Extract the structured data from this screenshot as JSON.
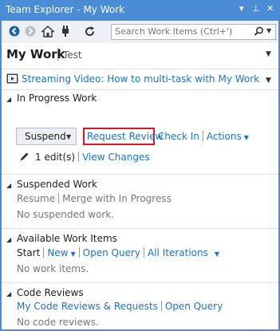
{
  "window": {
    "title": "Team Explorer - My Work",
    "controls": {
      "dropdown": "▾",
      "pin": "⊥",
      "close": "✕"
    }
  },
  "toolbar": {
    "icons": [
      "back-icon",
      "forward-icon",
      "home-icon",
      "connect-icon",
      "refresh-icon"
    ],
    "search_placeholder": "Search Work Items (Ctrl+')"
  },
  "header": {
    "title": "My Work",
    "subtitle": "Test"
  },
  "video": {
    "link_text": "Streaming Video: How to multi-task with My Work"
  },
  "in_progress": {
    "heading": "In Progress Work",
    "suspend_label": "Suspend",
    "request_review": "Request Review",
    "check_in": "Check In",
    "actions": "Actions",
    "edits": "1 edit(s)",
    "view_changes": "View Changes"
  },
  "suspended": {
    "heading": "Suspended Work",
    "resume": "Resume",
    "merge": "Merge with In Progress",
    "empty": "No suspended work."
  },
  "available": {
    "heading": "Available Work Items",
    "start": "Start",
    "new": "New",
    "open_query": "Open Query",
    "all_iterations": "All Iterations",
    "empty": "No work items."
  },
  "code_reviews": {
    "heading": "Code Reviews",
    "my_reviews": "My Code Reviews & Requests",
    "open_query": "Open Query",
    "empty": "No code reviews."
  },
  "colors": {
    "accent": "#4a8cd6",
    "link": "#1e72c8",
    "highlight_border": "#e0141e"
  }
}
